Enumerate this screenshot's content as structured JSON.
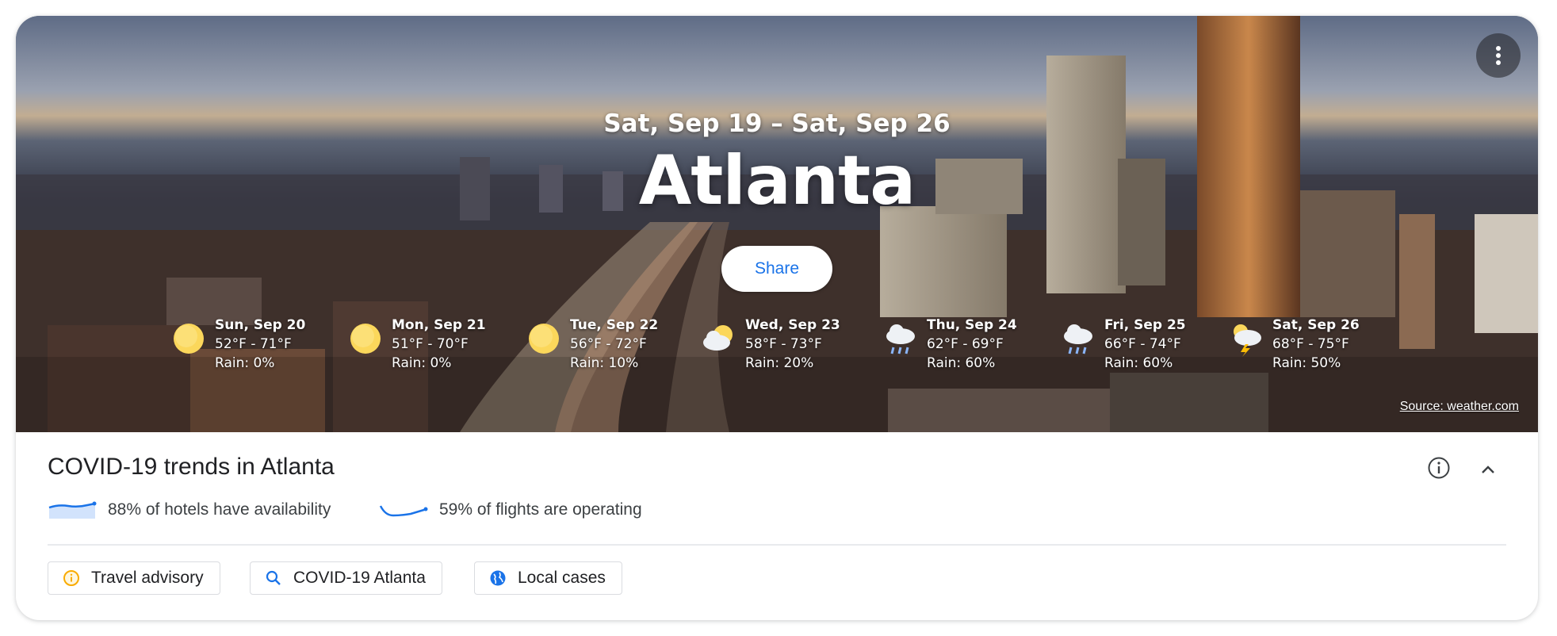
{
  "hero": {
    "date_range": "Sat, Sep 19 – Sat, Sep 26",
    "city": "Atlanta",
    "share_label": "Share",
    "more_icon": "more-vert-icon",
    "source_label": "Source: weather.com"
  },
  "forecast": [
    {
      "day": "Sun, Sep 20",
      "temp": "52°F - 71°F",
      "rain": "Rain: 0%",
      "icon": "sunny-icon"
    },
    {
      "day": "Mon, Sep 21",
      "temp": "51°F - 70°F",
      "rain": "Rain: 0%",
      "icon": "sunny-icon"
    },
    {
      "day": "Tue, Sep 22",
      "temp": "56°F - 72°F",
      "rain": "Rain: 10%",
      "icon": "sunny-icon"
    },
    {
      "day": "Wed, Sep 23",
      "temp": "58°F - 73°F",
      "rain": "Rain: 20%",
      "icon": "partly-cloudy-icon"
    },
    {
      "day": "Thu, Sep 24",
      "temp": "62°F - 69°F",
      "rain": "Rain: 60%",
      "icon": "rain-icon"
    },
    {
      "day": "Fri, Sep 25",
      "temp": "66°F - 74°F",
      "rain": "Rain: 60%",
      "icon": "rain-icon"
    },
    {
      "day": "Sat, Sep 26",
      "temp": "68°F - 75°F",
      "rain": "Rain: 50%",
      "icon": "thunderstorm-icon"
    }
  ],
  "covid": {
    "title": "COVID-19 trends in Atlanta",
    "hotels": "88% of hotels have availability",
    "flights": "59% of flights are operating"
  },
  "chips": {
    "travel_advisory": "Travel advisory",
    "covid_atlanta": "COVID-19 Atlanta",
    "local_cases": "Local cases"
  },
  "colors": {
    "accent": "#1a73e8",
    "advisory": "#f9ab00",
    "text": "#202124"
  }
}
